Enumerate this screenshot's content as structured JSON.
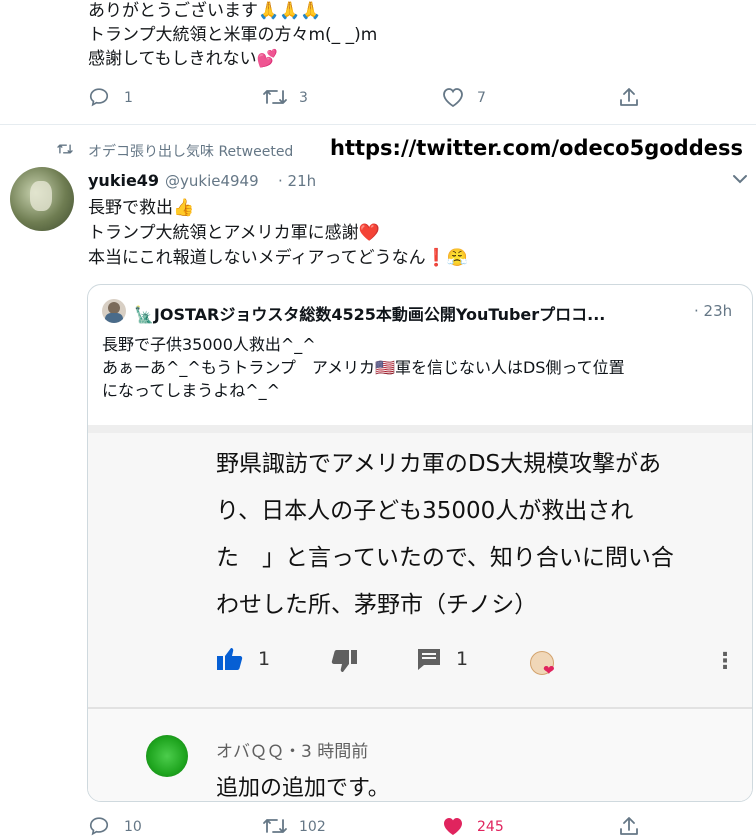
{
  "tweet1": {
    "lines": [
      "ありがとうございます🙏🙏🙏",
      "トランプ大統領と米軍の方々m(_ _)m",
      "感謝してもしきれない💕"
    ],
    "reply_count": "1",
    "retweet_count": "3",
    "like_count": "7"
  },
  "retweet_context": {
    "label": "オデコ張り出し気味 Retweeted",
    "url": "https://twitter.com/odeco5goddess"
  },
  "tweet2": {
    "display_name": "yukie49",
    "handle": "@yukie4949",
    "time": "· 21h",
    "lines": [
      "長野で救出👍",
      "トランプ大統領とアメリカ軍に感謝❤️",
      "本当にこれ報道しないメディアってどうなん❗😤"
    ],
    "reply_count": "10",
    "retweet_count": "102",
    "like_count": "245"
  },
  "quote": {
    "display_name": "🗽JOSTARジョウスタ総数4525本動画公開YouTuberプロコ...",
    "time": "· 23h",
    "lines": [
      "長野で子供35000人救出^_^",
      "あぁーあ^_^もうトランプ　アメリカ🇺🇸軍を信じない人はDS側って位置",
      "になってしまうよね^_^"
    ],
    "media": {
      "text_lines": [
        "野県諏訪でアメリカ軍のDS大規模攻撃があ",
        "り、日本人の子ども35000人が救出され",
        "た　」と言っていたので、知り合いに問い合",
        "わせした所、茅野市（チノシ）"
      ],
      "like_count": "1",
      "reply_count": "1",
      "reply_author": "オバＱＱ・3 時間前",
      "reply_text": "追加の追加です。"
    }
  },
  "colors": {
    "accent": "#1da1f2",
    "like_red": "#e0245e",
    "yt_blue": "#065fd4",
    "gray": "#657786"
  }
}
